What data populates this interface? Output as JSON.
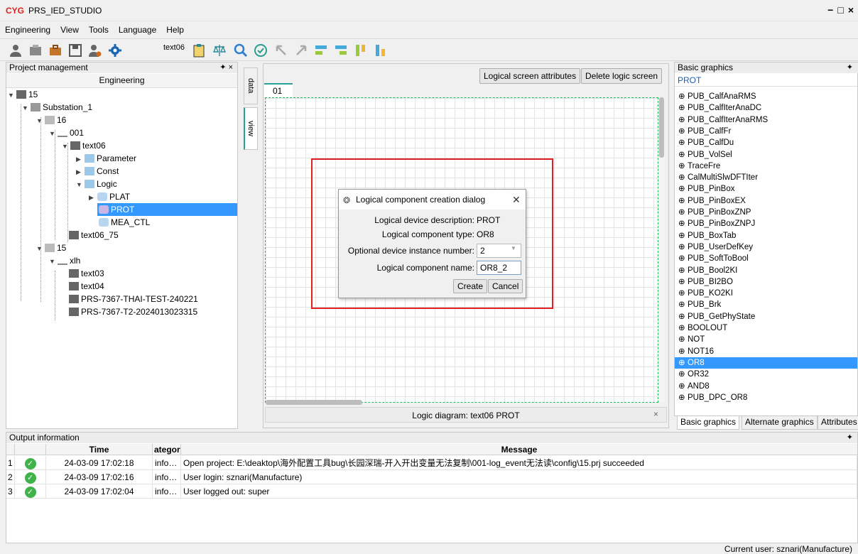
{
  "app": {
    "logo": "CYG",
    "title": "PRS_IED_STUDIO"
  },
  "menu": [
    "Engineering",
    "View",
    "Tools",
    "Language",
    "Help"
  ],
  "toolbar": {
    "text_label": "text06"
  },
  "project_panel": {
    "title": "Project management",
    "header": "Engineering",
    "tree": [
      {
        "label": "15"
      },
      {
        "label": "Substation_1"
      },
      {
        "label": "16"
      },
      {
        "label": "001"
      },
      {
        "label": "text06"
      },
      {
        "label": "Parameter"
      },
      {
        "label": "Const"
      },
      {
        "label": "Logic"
      },
      {
        "label": "PLAT"
      },
      {
        "label": "PROT"
      },
      {
        "label": "MEA_CTL"
      },
      {
        "label": "text06_75"
      },
      {
        "label": "15"
      },
      {
        "label": "xlh"
      },
      {
        "label": "text03"
      },
      {
        "label": "text04"
      },
      {
        "label": "PRS-7367-THAI-TEST-240221"
      },
      {
        "label": "PRS-7367-T2-2024013023315"
      }
    ]
  },
  "side_tabs": {
    "data": "data",
    "view": "view"
  },
  "center": {
    "btn_attributes": "Logical screen attributes",
    "btn_delete": "Delete logic screen",
    "tab": "01",
    "caption": "Logic diagram: text06 PROT",
    "close": "×"
  },
  "dialog": {
    "title": "Logical component creation dialog",
    "close": "✕",
    "desc_label": "Logical device description:",
    "desc_value": "PROT",
    "type_label": "Logical component type:",
    "type_value": "OR8",
    "instance_label": "Optional device instance number:",
    "instance_value": "2",
    "name_label": "Logical component name:",
    "name_value": "OR8_2",
    "create": "Create",
    "cancel": "Cancel"
  },
  "right_panel": {
    "title": "Basic graphics",
    "selected_group": "PROT",
    "items": [
      "PUB_CalfAnaRMS",
      "PUB_CalfIterAnaDC",
      "PUB_CalfIterAnaRMS",
      "PUB_CalfFr",
      "PUB_CalfDu",
      "PUB_VolSel",
      "TraceFre",
      "CalMultiSlwDFTIter",
      "PUB_PinBox",
      "PUB_PinBoxEX",
      "PUB_PinBoxZNP",
      "PUB_PinBoxZNPJ",
      "PUB_BoxTab",
      "PUB_UserDefKey",
      "PUB_SoftToBool",
      "PUB_Bool2KI",
      "PUB_BI2BO",
      "PUB_KO2KI",
      "PUB_Brk",
      "PUB_GetPhyState",
      "BOOLOUT",
      "NOT",
      "NOT16",
      "OR8",
      "OR32",
      "AND8",
      "PUB_DPC_OR8"
    ],
    "selected_item": "OR8",
    "tabs": [
      "Basic graphics",
      "Alternate graphics",
      "Attributes"
    ]
  },
  "output": {
    "title": "Output information",
    "columns": [
      "Time",
      "ategor",
      "Message"
    ],
    "rows": [
      {
        "n": "1",
        "time": "24-03-09 17:02:18",
        "cat": "info…",
        "msg": "Open project: E:\\deaktop\\海外配置工具bug\\长园深瑞-开入开出变量无法复制\\001-log_event无法读\\config\\15.prj succeeded"
      },
      {
        "n": "2",
        "time": "24-03-09 17:02:16",
        "cat": "info…",
        "msg": "User login: sznari(Manufacture)"
      },
      {
        "n": "3",
        "time": "24-03-09 17:02:04",
        "cat": "info…",
        "msg": "User logged out: super"
      }
    ]
  },
  "status": "Current user: sznari(Manufacture)",
  "colors": {
    "accent": "#3399ff",
    "red_highlight": "#e02020",
    "ok_green": "#3fb24a"
  }
}
